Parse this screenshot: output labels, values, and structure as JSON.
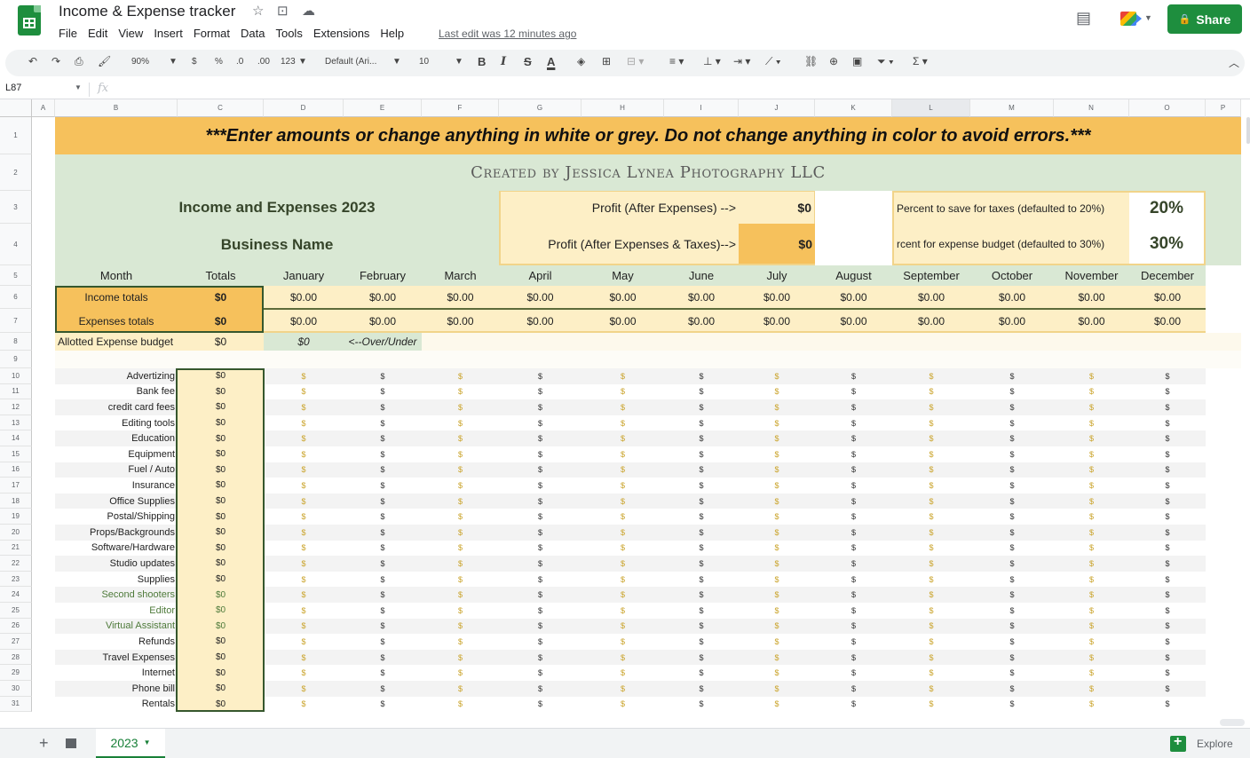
{
  "app": {
    "title": "Income & Expense tracker",
    "menu": [
      "File",
      "Edit",
      "View",
      "Insert",
      "Format",
      "Data",
      "Tools",
      "Extensions",
      "Help"
    ],
    "last_edit": "Last edit was 12 minutes ago",
    "share_label": "Share"
  },
  "toolbar": {
    "zoom": "90%",
    "currency": "$",
    "percent": "%",
    "dec_decrease": ".0",
    "dec_increase": ".00",
    "number_format": "123",
    "font": "Default (Ari...",
    "font_size": "10",
    "bold": "B",
    "italic": "I",
    "strike": "S",
    "text_color": "A"
  },
  "formula_bar": {
    "cell_ref": "L87",
    "fx": "fx"
  },
  "grid": {
    "columns": [
      "A",
      "B",
      "C",
      "D",
      "E",
      "F",
      "G",
      "H",
      "I",
      "J",
      "K",
      "L",
      "M",
      "N",
      "O",
      "P"
    ],
    "selected_column": "L",
    "rows": [
      "1",
      "2",
      "3",
      "4",
      "5",
      "6",
      "7",
      "8",
      "9",
      "10",
      "11",
      "12",
      "13",
      "14",
      "15",
      "16",
      "17",
      "18",
      "19",
      "20",
      "21",
      "22",
      "23",
      "24",
      "25",
      "26",
      "27",
      "28",
      "29",
      "30",
      "31"
    ]
  },
  "sheet": {
    "warning": "***Enter amounts or change anything in white or grey. Do not change anything in color to avoid errors.***",
    "credit": "Created by Jessica Lynea Photography LLC",
    "title": "Income and Expenses 2023",
    "business_name": "Business Name",
    "profit_label": "Profit (After Expenses) -->",
    "profit_value": "$0",
    "profit_taxes_label": "Profit (After Expenses & Taxes)-->",
    "profit_taxes_value": "$0",
    "tax_label": "Percent to save for taxes (defaulted to 20%)",
    "tax_value": "20%",
    "budget_label": "rcent for expense budget (defaulted to 30%)",
    "budget_value": "30%",
    "month_header": "Month",
    "totals_header": "Totals",
    "months": [
      "January",
      "February",
      "March",
      "April",
      "May",
      "June",
      "July",
      "August",
      "September",
      "October",
      "November",
      "December"
    ],
    "income_label": "Income totals",
    "income_total": "$0",
    "income_values": [
      "$0.00",
      "$0.00",
      "$0.00",
      "$0.00",
      "$0.00",
      "$0.00",
      "$0.00",
      "$0.00",
      "$0.00",
      "$0.00",
      "$0.00",
      "$0.00"
    ],
    "expenses_label": "Expenses totals",
    "expenses_total": "$0",
    "expenses_values": [
      "$0.00",
      "$0.00",
      "$0.00",
      "$0.00",
      "$0.00",
      "$0.00",
      "$0.00",
      "$0.00",
      "$0.00",
      "$0.00",
      "$0.00",
      "$0.00"
    ],
    "allotted_label": "Allotted Expense budget",
    "allotted_total": "$0",
    "over_under_value": "$0",
    "over_under_label": "<--Over/Under",
    "cell_dollar": "$",
    "expense_categories": [
      {
        "label": "Advertizing",
        "total": "$0",
        "green": false
      },
      {
        "label": "Bank fee",
        "total": "$0",
        "green": false
      },
      {
        "label": "credit card fees",
        "total": "$0",
        "green": false
      },
      {
        "label": "Editing tools",
        "total": "$0",
        "green": false
      },
      {
        "label": "Education",
        "total": "$0",
        "green": false
      },
      {
        "label": "Equipment",
        "total": "$0",
        "green": false
      },
      {
        "label": "Fuel / Auto",
        "total": "$0",
        "green": false
      },
      {
        "label": "Insurance",
        "total": "$0",
        "green": false
      },
      {
        "label": "Office Supplies",
        "total": "$0",
        "green": false
      },
      {
        "label": "Postal/Shipping",
        "total": "$0",
        "green": false
      },
      {
        "label": "Props/Backgrounds",
        "total": "$0",
        "green": false
      },
      {
        "label": "Software/Hardware",
        "total": "$0",
        "green": false
      },
      {
        "label": "Studio updates",
        "total": "$0",
        "green": false
      },
      {
        "label": "Supplies",
        "total": "$0",
        "green": false
      },
      {
        "label": "Second shooters",
        "total": "$0",
        "green": true
      },
      {
        "label": "Editor",
        "total": "$0",
        "green": true
      },
      {
        "label": "Virtual Assistant",
        "total": "$0",
        "green": true
      },
      {
        "label": "Refunds",
        "total": "$0",
        "green": false
      },
      {
        "label": "Travel Expenses",
        "total": "$0",
        "green": false
      },
      {
        "label": "Internet",
        "total": "$0",
        "green": false
      },
      {
        "label": "Phone bill",
        "total": "$0",
        "green": false
      },
      {
        "label": "Rentals",
        "total": "$0",
        "green": false
      }
    ]
  },
  "tabs": {
    "active_sheet": "2023",
    "explore_label": "Explore"
  },
  "colors": {
    "banner_yellow": "#f6c15c",
    "pale_yellow": "#fdefc6",
    "light_green": "#d9e8d4",
    "outline_green": "#36572d",
    "share_green": "#1e8e3e"
  }
}
